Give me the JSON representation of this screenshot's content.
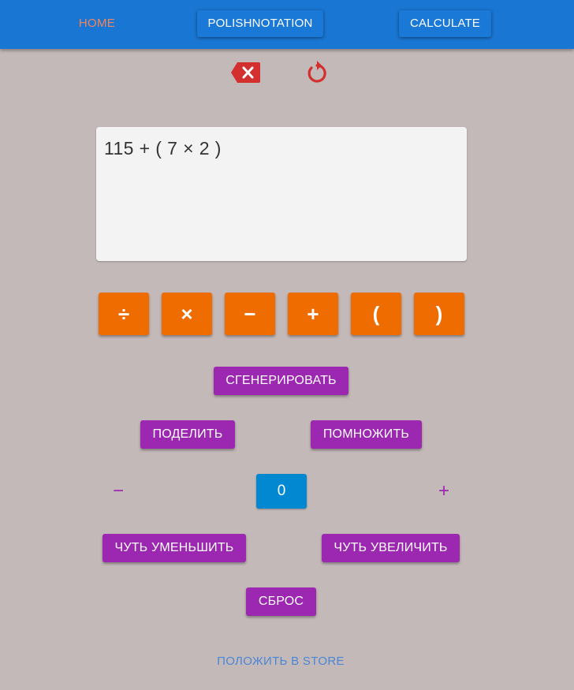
{
  "nav": {
    "home": "HOME",
    "polish": "POLISHNOTATION",
    "calculate": "CALCULATE"
  },
  "toolbar": {
    "backspace_icon": "backspace-icon",
    "reset_icon": "reset-icon",
    "icon_color": "#d32f2f"
  },
  "expression": "115 + ( 7 × 2 )",
  "operators": [
    "÷",
    "×",
    "−",
    "+",
    "(",
    ")"
  ],
  "actions": {
    "generate": "СГЕНЕРИРОВАТЬ",
    "divide": "ПОДЕЛИТЬ",
    "multiply": "ПОМНОЖИТЬ",
    "decrease": "ЧУТЬ УМЕНЬШИТЬ",
    "increase": "ЧУТЬ УВЕЛИЧИТЬ",
    "reset": "СБРОС"
  },
  "counter": {
    "minus": "−",
    "value": "0",
    "plus": "+"
  },
  "store_link": "ПОЛОЖИТЬ В STORE",
  "colors": {
    "appbar": "#1976d2",
    "background": "#c4b9b9",
    "operator": "#ef6c00",
    "action": "#9c27b0",
    "counter": "#0288d1",
    "home_active": "#f4845c"
  }
}
